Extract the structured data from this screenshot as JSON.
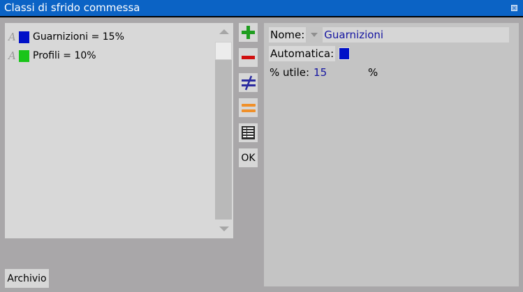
{
  "window": {
    "title": "Classi di sfrido commessa"
  },
  "list": {
    "items": [
      {
        "label": "Guarnizioni = 15%",
        "color": "#0010c8"
      },
      {
        "label": "Profili = 10%",
        "color": "#19c519"
      }
    ]
  },
  "toolbar": {
    "add_icon": "plus-icon",
    "remove_icon": "minus-icon",
    "not_equal_icon": "not-equal-icon",
    "equal_icon": "equal-icon",
    "table_icon": "table-icon",
    "ok_label": "OK"
  },
  "footer": {
    "archivio_label": "Archivio"
  },
  "details": {
    "name_label": "Nome:",
    "name_value": "Guarnizioni",
    "auto_label": "Automatica:",
    "auto_checked": true,
    "pct_label": "% utile:",
    "pct_value": "15",
    "pct_unit": "%"
  },
  "colors": {
    "accent": "#0b63c5",
    "value_text": "#1414a0"
  }
}
